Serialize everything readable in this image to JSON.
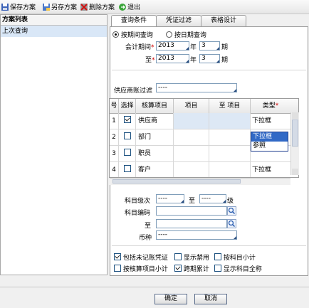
{
  "toolbar": {
    "save": "保存方案",
    "save_as": "另存方案",
    "delete": "删除方案",
    "exit": "退出"
  },
  "sidebar": {
    "title": "方案列表",
    "items": [
      "上次查询"
    ]
  },
  "tabs": [
    "查询条件",
    "凭证过滤",
    "表格设计"
  ],
  "period": {
    "option_period": "按期间查询",
    "option_date": "按日期查询",
    "from_label": "会计期间",
    "to_label": "至",
    "req": "*",
    "from_year": "2013",
    "from_period": "3",
    "to_year": "2013",
    "to_period": "3",
    "year_unit": "年",
    "period_unit": "期"
  },
  "supplier_filter": {
    "label": "供应商账过滤",
    "value": "----"
  },
  "grid": {
    "headers": [
      "号",
      "选择",
      "核算项目",
      "项目",
      "至 项目",
      "类型"
    ],
    "type_req": "*",
    "rows": [
      {
        "no": "1",
        "checked": true,
        "item": "供应商",
        "type": "下拉框"
      },
      {
        "no": "2",
        "checked": false,
        "item": "部门",
        "type": ""
      },
      {
        "no": "3",
        "checked": false,
        "item": "职员",
        "type": ""
      },
      {
        "no": "4",
        "checked": false,
        "item": "客户",
        "type": "下拉框"
      }
    ],
    "dropdown_options": [
      "下拉框",
      "参照"
    ]
  },
  "subject": {
    "level_label": "科目级次",
    "level_from": "----",
    "level_to_label": "至",
    "level_to": "----",
    "level_unit": "级",
    "code_label": "科目编码",
    "code_to_label": "至",
    "currency_label": "币种",
    "currency_value": "----"
  },
  "options": [
    {
      "label": "包括未记账凭证",
      "checked": true
    },
    {
      "label": "显示禁用",
      "checked": false
    },
    {
      "label": "按科目小计",
      "checked": false
    },
    {
      "label": "按核算项目小计",
      "checked": false
    },
    {
      "label": "跨期累计",
      "checked": true
    },
    {
      "label": "显示科目全称",
      "checked": false
    }
  ],
  "buttons": {
    "ok": "确定",
    "cancel": "取消"
  }
}
